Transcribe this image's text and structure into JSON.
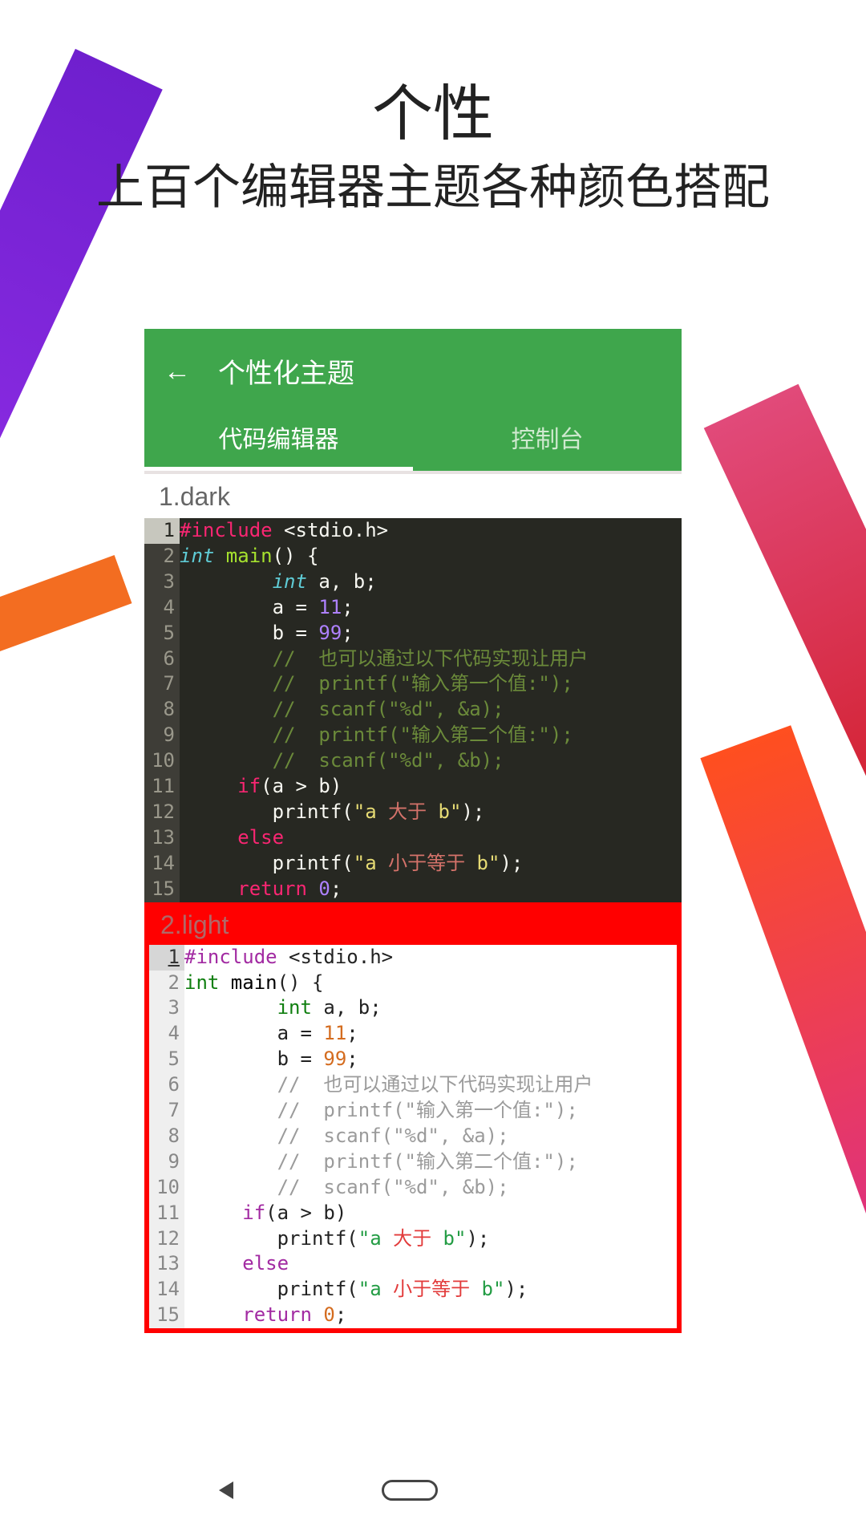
{
  "promo": {
    "title": "个性",
    "subtitle": "上百个编辑器主题各种颜色搭配"
  },
  "appbar": {
    "title": "个性化主题"
  },
  "tabs": {
    "editor": "代码编辑器",
    "console": "控制台"
  },
  "theme1": {
    "label": "1.dark"
  },
  "theme2": {
    "label": "2.light"
  },
  "code": {
    "l1_prep": "#include",
    "l1_hdr": " <stdio.h>",
    "l2_type": "int",
    "l2_fn": " main",
    "l2_rest": "() {",
    "l3_indent": "        ",
    "l3_type": "int",
    "l3_rest": " a, b;",
    "l4_indent": "        a = ",
    "l4_num": "11",
    "l4_semi": ";",
    "l5_indent": "        b = ",
    "l5_num": "99",
    "l5_semi": ";",
    "l6": "        //  也可以通过以下代码实现让用户",
    "l7": "        //  printf(\"输入第一个值:\");",
    "l8": "        //  scanf(\"%d\", &a);",
    "l9": "        //  printf(\"输入第二个值:\");",
    "l10": "        //  scanf(\"%d\", &b);",
    "l11_indent": "     ",
    "l11_if": "if",
    "l11_rest": "(a > b)",
    "l12_indent": "        printf(",
    "l12_str_q": "\"a ",
    "l12_cn": "大于",
    "l12_str_end": " b\"",
    "l12_close": ");",
    "l13_indent": "     ",
    "l13_else": "else",
    "l14_indent": "        printf(",
    "l14_str_q": "\"a ",
    "l14_cn": "小于等于",
    "l14_str_end": " b\"",
    "l14_close": ");",
    "l15_indent": "     ",
    "l15_ret": "return",
    "l15_sp": " ",
    "l15_num": "0",
    "l15_semi": ";"
  },
  "ln": {
    "n1": "1",
    "n2": "2",
    "n3": "3",
    "n4": "4",
    "n5": "5",
    "n6": "6",
    "n7": "7",
    "n8": "8",
    "n9": "9",
    "n10": "10",
    "n11": "11",
    "n12": "12",
    "n13": "13",
    "n14": "14",
    "n15": "15"
  }
}
